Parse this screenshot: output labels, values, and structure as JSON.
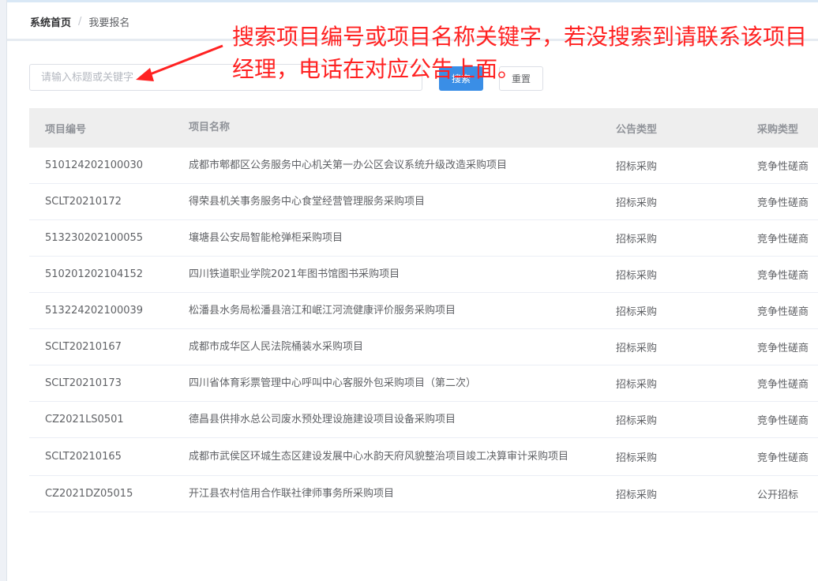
{
  "breadcrumb": {
    "home": "系统首页",
    "separator": "/",
    "current": "我要报名"
  },
  "search": {
    "placeholder": "请输入标题或关键字",
    "value": "",
    "search_label": "搜索",
    "reset_label": "重置"
  },
  "annotation": {
    "text": "搜索项目编号或项目名称关键字，若没搜索到请联系该项目经理，电话在对应公告上面。",
    "color": "#ff2222"
  },
  "table": {
    "headers": [
      "项目编号",
      "项目名称",
      "公告类型",
      "采购类型"
    ],
    "rows": [
      [
        "510124202100030",
        "成都市郫都区公务服务中心机关第一办公区会议系统升级改造采购项目",
        "招标采购",
        "竞争性磋商"
      ],
      [
        "SCLT20210172",
        "得荣县机关事务服务中心食堂经营管理服务采购项目",
        "招标采购",
        "竞争性磋商"
      ],
      [
        "513230202100055",
        "壤塘县公安局智能枪弹柜采购项目",
        "招标采购",
        "竞争性磋商"
      ],
      [
        "510201202104152",
        "四川铁道职业学院2021年图书馆图书采购项目",
        "招标采购",
        "竞争性磋商"
      ],
      [
        "513224202100039",
        "松潘县水务局松潘县涪江和岷江河流健康评价服务采购项目",
        "招标采购",
        "竞争性磋商"
      ],
      [
        "SCLT20210167",
        "成都市成华区人民法院桶装水采购项目",
        "招标采购",
        "竞争性磋商"
      ],
      [
        "SCLT20210173",
        "四川省体育彩票管理中心呼叫中心客服外包采购项目（第二次）",
        "招标采购",
        "竞争性磋商"
      ],
      [
        "CZ2021LS0501",
        "德昌县供排水总公司废水预处理设施建设项目设备采购项目",
        "招标采购",
        "竞争性磋商"
      ],
      [
        "SCLT20210165",
        "成都市武侯区环城生态区建设发展中心水韵天府风貌整治项目竣工决算审计采购项目",
        "招标采购",
        "竞争性磋商"
      ],
      [
        "CZ2021DZ05015",
        "开江县农村信用合作联社律师事务所采购项目",
        "招标采购",
        "公开招标"
      ]
    ]
  },
  "colors": {
    "primary_button": "#3a8ee6",
    "header_bg": "#eeeeee",
    "annotation": "#ff2222"
  }
}
